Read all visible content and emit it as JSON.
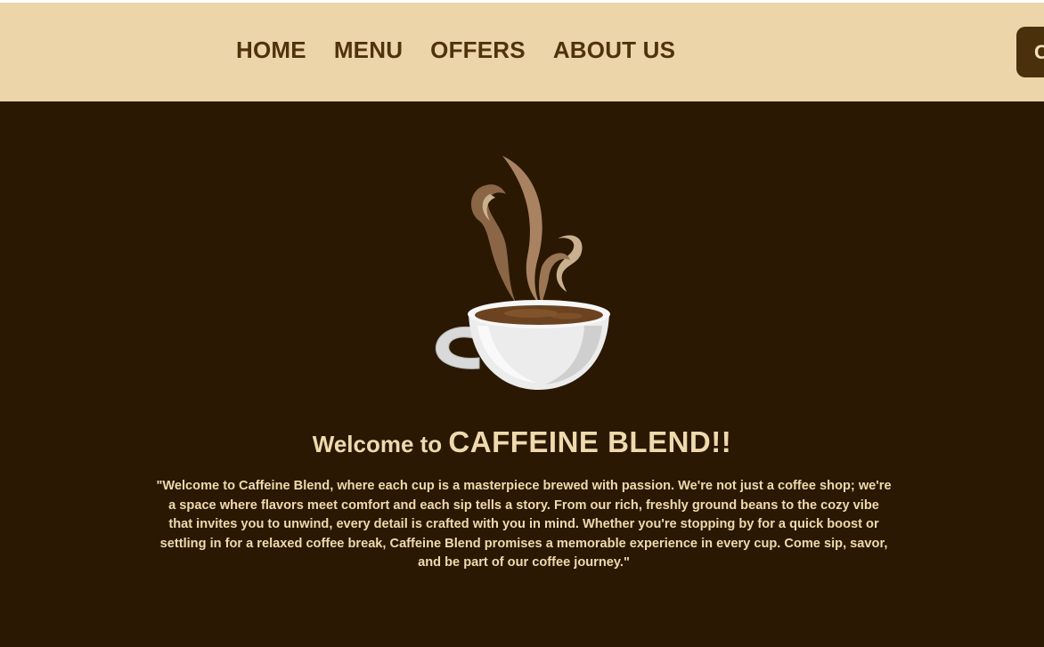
{
  "nav": {
    "items": [
      {
        "label": "HOME"
      },
      {
        "label": "MENU"
      },
      {
        "label": "OFFERS"
      },
      {
        "label": "ABOUT US"
      }
    ],
    "cta_label": "C"
  },
  "hero": {
    "title_prefix": "Welcome to ",
    "title_brand": "CAFFEINE BLEND!!",
    "description": "\"Welcome to Caffeine Blend, where each cup is a masterpiece brewed with passion. We're not just a coffee shop; we're a space where flavors meet comfort and each sip tells a story. From our rich, freshly ground beans to the cozy vibe that invites you to unwind, every detail is crafted with you in mind. Whether you're stopping by for a quick boost or settling in for a relaxed coffee break, Caffeine Blend promises a memorable experience in every cup. Come sip, savor, and be part of our coffee journey.\"",
    "illustration_icon": "coffee-cup-steam-icon"
  },
  "colors": {
    "navbar_bg": "#ecd5a8",
    "nav_text": "#4f330c",
    "hero_bg": "#2a1803",
    "hero_text": "#efd9ad",
    "cta_bg": "#4a310b"
  }
}
